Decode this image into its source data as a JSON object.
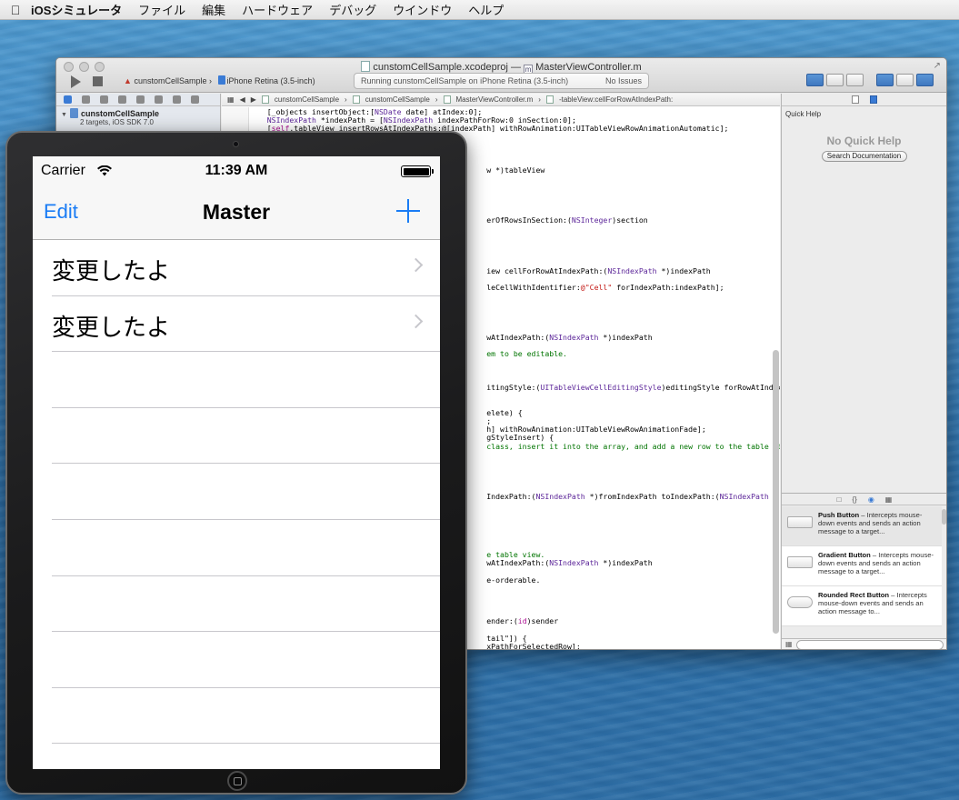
{
  "menubar": {
    "app": "iOSシミュレータ",
    "items": [
      "ファイル",
      "編集",
      "ハードウェア",
      "デバッグ",
      "ウインドウ",
      "ヘルプ"
    ]
  },
  "xcode": {
    "project_file": "cunstomCellSample.xcodeproj",
    "separator": "—",
    "source_file": "MasterViewController.m",
    "scheme": "cunstomCellSample",
    "device": "iPhone Retina (3.5-inch)",
    "activity_text": "Running cunstomCellSample on iPhone Retina (3.5-inch)",
    "issues": "No Issues",
    "navigator": {
      "project_name": "cunstomCellSample",
      "project_sub": "2 targets, iOS SDK 7.0"
    },
    "jumpbar": [
      "cunstomCellSample",
      "cunstomCellSample",
      "MasterViewController.m",
      "-tableView:cellForRowAtIndexPath:"
    ],
    "code_lines": [
      {
        "n": "46",
        "t": "    [_objects insertObject:[NSDate date] atIndex:0];"
      },
      {
        "n": "47",
        "t": "    NSIndexPath *indexPath = [NSIndexPath indexPathForRow:0 inSection:0];"
      },
      {
        "n": "48",
        "t": "    [self.tableView insertRowsAtIndexPaths:@[indexPath] withRowAnimation:UITableViewRowAnimationAutomatic];"
      },
      {
        "n": "",
        "t": ""
      },
      {
        "n": "",
        "t": ""
      },
      {
        "n": "",
        "t": ""
      },
      {
        "n": "",
        "t": ""
      },
      {
        "n": "",
        "t": "                                                     w *)tableView"
      },
      {
        "n": "",
        "t": ""
      },
      {
        "n": "",
        "t": ""
      },
      {
        "n": "",
        "t": ""
      },
      {
        "n": "",
        "t": ""
      },
      {
        "n": "",
        "t": ""
      },
      {
        "n": "",
        "t": "                                                     erOfRowsInSection:(NSInteger)section"
      },
      {
        "n": "",
        "t": ""
      },
      {
        "n": "",
        "t": ""
      },
      {
        "n": "",
        "t": ""
      },
      {
        "n": "",
        "t": ""
      },
      {
        "n": "",
        "t": ""
      },
      {
        "n": "",
        "t": "                                                     iew cellForRowAtIndexPath:(NSIndexPath *)indexPath"
      },
      {
        "n": "",
        "t": ""
      },
      {
        "n": "",
        "t": "                                                     leCellWithIdentifier:@\"Cell\" forIndexPath:indexPath];"
      },
      {
        "n": "",
        "t": ""
      },
      {
        "n": "",
        "t": ""
      },
      {
        "n": "",
        "t": ""
      },
      {
        "n": "",
        "t": ""
      },
      {
        "n": "",
        "t": ""
      },
      {
        "n": "",
        "t": "                                                     wAtIndexPath:(NSIndexPath *)indexPath"
      },
      {
        "n": "",
        "t": ""
      },
      {
        "n": "",
        "t": "                                                     em to be editable."
      },
      {
        "n": "",
        "t": ""
      },
      {
        "n": "",
        "t": ""
      },
      {
        "n": "",
        "t": ""
      },
      {
        "n": "",
        "t": "                                                     itingStyle:(UITableViewCellEditingStyle)editingStyle forRowAtIndexPath:"
      },
      {
        "n": "",
        "t": ""
      },
      {
        "n": "",
        "t": ""
      },
      {
        "n": "",
        "t": "                                                     elete) {"
      },
      {
        "n": "",
        "t": "                                                     ;"
      },
      {
        "n": "",
        "t": "                                                     h] withRowAnimation:UITableViewRowAnimationFade];"
      },
      {
        "n": "",
        "t": "                                                     gStyleInsert) {"
      },
      {
        "n": "",
        "t": "                                                     class, insert it into the array, and add a new row to the table view."
      },
      {
        "n": "",
        "t": ""
      },
      {
        "n": "",
        "t": ""
      },
      {
        "n": "",
        "t": ""
      },
      {
        "n": "",
        "t": ""
      },
      {
        "n": "",
        "t": ""
      },
      {
        "n": "",
        "t": "                                                     IndexPath:(NSIndexPath *)fromIndexPath toIndexPath:(NSIndexPath"
      },
      {
        "n": "",
        "t": ""
      },
      {
        "n": "",
        "t": ""
      },
      {
        "n": "",
        "t": ""
      },
      {
        "n": "",
        "t": ""
      },
      {
        "n": "",
        "t": ""
      },
      {
        "n": "",
        "t": ""
      },
      {
        "n": "",
        "t": "                                                     e table view."
      },
      {
        "n": "",
        "t": "                                                     wAtIndexPath:(NSIndexPath *)indexPath"
      },
      {
        "n": "",
        "t": ""
      },
      {
        "n": "",
        "t": "                                                     e-orderable."
      },
      {
        "n": "",
        "t": ""
      },
      {
        "n": "",
        "t": ""
      },
      {
        "n": "",
        "t": ""
      },
      {
        "n": "",
        "t": ""
      },
      {
        "n": "",
        "t": "                                                     ender:(id)sender"
      },
      {
        "n": "",
        "t": ""
      },
      {
        "n": "",
        "t": "                                                     tail\"]) {"
      },
      {
        "n": "",
        "t": "                                                     xPathForSelectedRow];"
      }
    ],
    "utility": {
      "heading": "Quick Help",
      "empty_text": "No Quick Help",
      "search_button": "Search Documentation",
      "library": [
        {
          "name": "Push Button",
          "desc": " – Intercepts mouse-down events and sends an action message to a target..."
        },
        {
          "name": "Gradient Button",
          "desc": " – Intercepts mouse-down events and sends an action message to a target..."
        },
        {
          "name": "Rounded Rect Button",
          "desc": " – Intercepts mouse-down events and sends an action message to..."
        }
      ]
    }
  },
  "simulator": {
    "carrier": "Carrier",
    "time": "11:39 AM",
    "nav": {
      "left": "Edit",
      "title": "Master"
    },
    "rows": [
      "変更したよ",
      "変更したよ"
    ],
    "tint": "#1a7cf5"
  }
}
